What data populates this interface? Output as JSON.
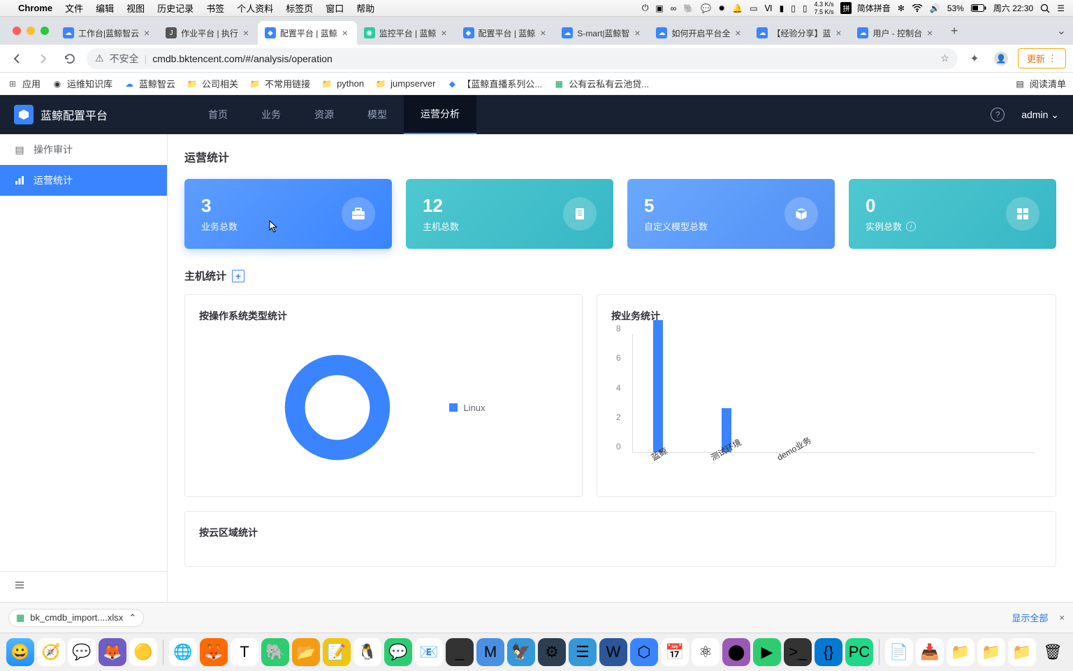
{
  "macos": {
    "app": "Chrome",
    "menus": [
      "文件",
      "编辑",
      "视图",
      "历史记录",
      "书签",
      "个人资料",
      "标签页",
      "窗口",
      "帮助"
    ],
    "battery": "53%",
    "time": "周六 22:30",
    "ime": "简体拼音",
    "net_up": "4.3 K/s",
    "net_down": "7.5 K/s"
  },
  "tabs": [
    {
      "title": "工作台|蓝鲸智云",
      "favicon": "#3a84ff"
    },
    {
      "title": "作业平台 | 执行",
      "favicon": "#555"
    },
    {
      "title": "配置平台 | 蓝鲸",
      "favicon": "#3a84ff",
      "active": true
    },
    {
      "title": "监控平台 | 蓝鲸",
      "favicon": "#2dcb9d"
    },
    {
      "title": "配置平台 | 蓝鲸",
      "favicon": "#3a84ff"
    },
    {
      "title": "S-mart|蓝鲸智",
      "favicon": "#3a84ff"
    },
    {
      "title": "如何开启平台全",
      "favicon": "#3a84ff"
    },
    {
      "title": "【经验分享】蓝",
      "favicon": "#3a84ff"
    },
    {
      "title": "用户 - 控制台",
      "favicon": "#3a84ff"
    }
  ],
  "address_bar": {
    "secure_label": "不安全",
    "url": "cmdb.bktencent.com/#/analysis/operation",
    "update_label": "更新"
  },
  "bookmarks": {
    "apps": "应用",
    "items": [
      "运维知识库",
      "蓝鲸智云",
      "公司相关",
      "不常用链接",
      "python",
      "jumpserver",
      "【蓝鲸直播系列公...",
      "公有云私有云池贷..."
    ],
    "read_list": "阅读清单"
  },
  "app": {
    "name": "蓝鲸配置平台",
    "nav": [
      "首页",
      "业务",
      "资源",
      "模型",
      "运营分析"
    ],
    "nav_active": 4,
    "user": "admin"
  },
  "sidebar": {
    "items": [
      {
        "label": "操作审计",
        "icon": "list"
      },
      {
        "label": "运营统计",
        "icon": "chart"
      }
    ],
    "active": 1
  },
  "page": {
    "title": "运营统计",
    "stats": [
      {
        "num": "3",
        "label": "业务总数",
        "variant": "blue",
        "icon": "briefcase"
      },
      {
        "num": "12",
        "label": "主机总数",
        "variant": "teal",
        "icon": "server"
      },
      {
        "num": "5",
        "label": "自定义模型总数",
        "variant": "bluev",
        "icon": "cube"
      },
      {
        "num": "0",
        "label": "实例总数",
        "variant": "teal",
        "icon": "grid",
        "info": true
      }
    ],
    "host_section": "主机统计",
    "chart_os_title": "按操作系统类型统计",
    "chart_biz_title": "按业务统计",
    "chart_cloud_title": "按云区域统计"
  },
  "chart_data": [
    {
      "type": "pie",
      "title": "按操作系统类型统计",
      "series": [
        {
          "name": "Linux",
          "value": 12,
          "color": "#3a84ff"
        }
      ],
      "legend": [
        "Linux"
      ]
    },
    {
      "type": "bar",
      "title": "按业务统计",
      "categories": [
        "蓝鲸",
        "测试环境",
        "demo业务"
      ],
      "values": [
        9,
        3,
        0
      ],
      "ylabel": "",
      "ylim": [
        0,
        8
      ],
      "yticks": [
        0,
        2,
        4,
        6,
        8
      ]
    }
  ],
  "download": {
    "file": "bk_cmdb_import....xlsx",
    "show_all": "显示全部"
  }
}
